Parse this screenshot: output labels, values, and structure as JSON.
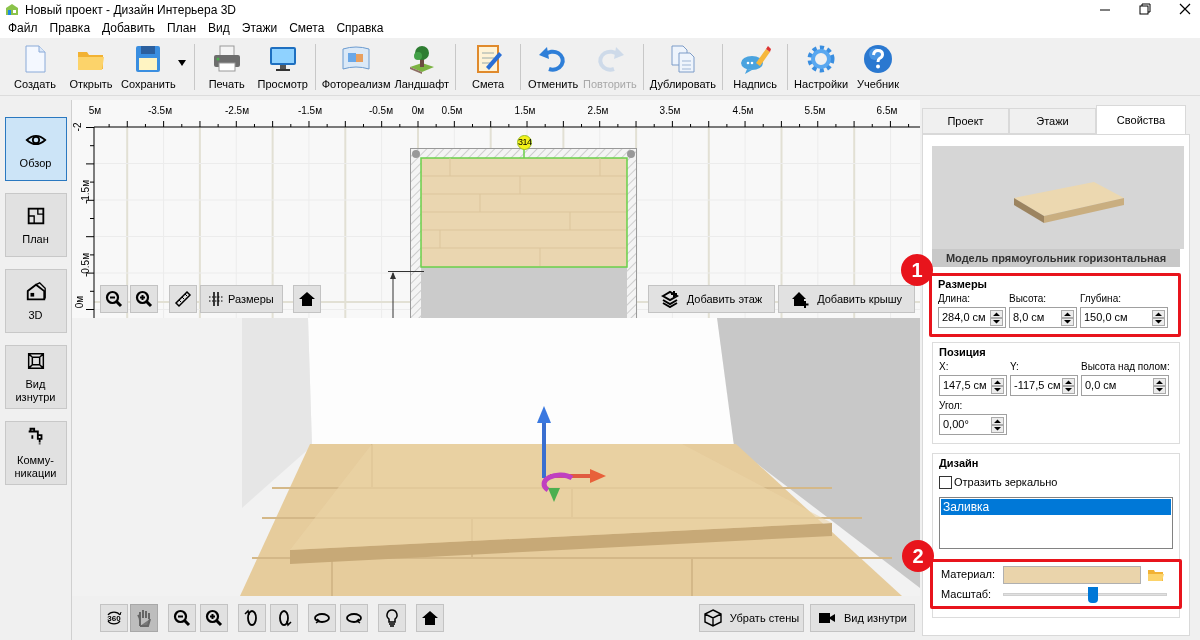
{
  "window": {
    "title": "Новый проект - Дизайн Интерьера 3D"
  },
  "menu": [
    "Файл",
    "Правка",
    "Добавить",
    "План",
    "Вид",
    "Этажи",
    "Смета",
    "Справка"
  ],
  "toolbar": [
    [
      {
        "label": "Создать",
        "kind": "button",
        "disabled": false
      },
      {
        "label": "Открыть",
        "kind": "button",
        "disabled": false
      },
      {
        "label": "Сохранить",
        "kind": "split",
        "disabled": false
      }
    ],
    [
      {
        "label": "Печать",
        "kind": "button",
        "disabled": false
      },
      {
        "label": "Просмотр",
        "kind": "button",
        "disabled": false
      }
    ],
    [
      {
        "label": "Фотореализм",
        "kind": "button",
        "disabled": false
      },
      {
        "label": "Ландшафт",
        "kind": "button",
        "disabled": false
      }
    ],
    [
      {
        "label": "Смета",
        "kind": "button",
        "disabled": false
      }
    ],
    [
      {
        "label": "Отменить",
        "kind": "button",
        "disabled": false
      },
      {
        "label": "Повторить",
        "kind": "button",
        "disabled": true
      }
    ],
    [
      {
        "label": "Дублировать",
        "kind": "button",
        "disabled": false
      }
    ],
    [
      {
        "label": "Надпись",
        "kind": "button",
        "disabled": false
      }
    ],
    [
      {
        "label": "Настройки",
        "kind": "button",
        "disabled": false
      },
      {
        "label": "Учебник",
        "kind": "button",
        "disabled": false
      }
    ]
  ],
  "sidebar": [
    {
      "label": "Обзор",
      "selected": true
    },
    {
      "label": "План",
      "selected": false
    },
    {
      "label": "3D",
      "selected": false
    },
    {
      "label": "Вид\nизнутри",
      "selected": false
    },
    {
      "label": "Комму-\nникации",
      "selected": false
    }
  ],
  "plan": {
    "x_labels": [
      "5м",
      "-3.5м",
      "-2.5м",
      "-1.5м",
      "-0.5м",
      "0м",
      "0.5м",
      "1.5м",
      "2.5м",
      "3.5м",
      "4.5м",
      "5.5м",
      "6.5м"
    ],
    "y_labels": [
      "-2",
      "-1.5м",
      "-0.5м",
      "0м"
    ],
    "dimension": "314",
    "dimensions_button": "Размеры",
    "actions": [
      "Добавить этаж",
      "Добавить крышу"
    ]
  },
  "view_tools": [
    [
      {
        "label": "360",
        "selected": false
      },
      {
        "selected": true
      }
    ],
    [
      {
        "selected": false
      },
      {
        "selected": false
      }
    ],
    [
      {
        "selected": false
      },
      {
        "selected": false
      }
    ],
    [
      {
        "selected": false
      },
      {
        "selected": false
      }
    ],
    [
      {
        "selected": false
      }
    ],
    [
      {
        "selected": false
      }
    ]
  ],
  "view_actions": [
    "Убрать стены",
    "Вид изнутри"
  ],
  "panel": {
    "tabs": [
      {
        "label": "Проект",
        "selected": false
      },
      {
        "label": "Этажи",
        "selected": false
      },
      {
        "label": "Свойства",
        "selected": true
      }
    ],
    "preview_caption": "Модель прямоугольник горизонтальная",
    "groups": [
      {
        "title": "Размеры",
        "annotation": "1",
        "fields": [
          {
            "label": "Длина:",
            "value": "284,0 см"
          },
          {
            "label": "Высота:",
            "value": "8,0 см"
          },
          {
            "label": "Глубина:",
            "value": "150,0 см"
          }
        ]
      },
      {
        "title": "Позиция",
        "fields": [
          {
            "label": "X:",
            "value": "147,5 см"
          },
          {
            "label": "Y:",
            "value": "-117,5 см"
          },
          {
            "label": "Высота над полом:",
            "value": "0,0 см"
          },
          {
            "label": "Угол:",
            "value": "0,00°"
          }
        ]
      }
    ],
    "design": {
      "title": "Дизайн",
      "mirror": {
        "label": "Отразить зеркально",
        "checked": false
      },
      "list": [
        {
          "label": "Заливка",
          "selected": true
        }
      ],
      "annotation": "2",
      "material_label": "Материал:",
      "scale_label": "Масштаб:",
      "scale": {
        "level": 0.55
      }
    }
  }
}
